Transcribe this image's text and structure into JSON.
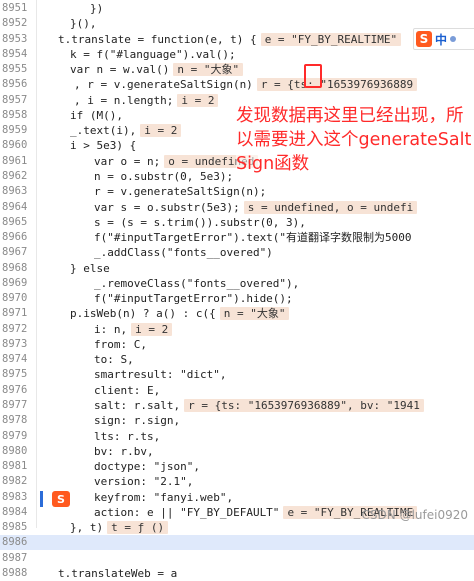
{
  "editor": {
    "lines": [
      {
        "n": "8951",
        "t": "})"
      },
      {
        "n": "8952",
        "t": "}(),"
      },
      {
        "n": "8953",
        "t": "t.translate = function(e, t) {",
        "h": "e = \"FY_BY_REALTIME\""
      },
      {
        "n": "8954",
        "t": "k = f(\"#language\").val();"
      },
      {
        "n": "8955",
        "t": "var n = w.val()",
        "h": "n = \"大象\""
      },
      {
        "n": "8956",
        "t": ", r = v.generateSaltSign(n)",
        "h": "r = {ts: \"1653976936889"
      },
      {
        "n": "8957",
        "t": ", i = n.length;",
        "h": "i = 2"
      },
      {
        "n": "8958",
        "t": "if (M(),"
      },
      {
        "n": "8959",
        "t": "_.text(i),",
        "h": "i = 2"
      },
      {
        "n": "8960",
        "t": "i > 5e3) {"
      },
      {
        "n": "8961",
        "t": "var o = n;",
        "h": "o = undefined"
      },
      {
        "n": "8962",
        "t": "n = o.substr(0, 5e3);"
      },
      {
        "n": "8963",
        "t": "r = v.generateSaltSign(n);"
      },
      {
        "n": "8964",
        "t": "var s = o.substr(5e3);",
        "h": "s = undefined, o = undefi"
      },
      {
        "n": "8965",
        "t": "s = (s = s.trim()).substr(0, 3),"
      },
      {
        "n": "8966",
        "t": "f(\"#inputTargetError\").text(\"有道翻译字数限制为5000"
      },
      {
        "n": "8967",
        "t": "_.addClass(\"fonts__overed\")"
      },
      {
        "n": "8968",
        "t": "} else"
      },
      {
        "n": "8969",
        "t": "_.removeClass(\"fonts__overed\"),"
      },
      {
        "n": "8970",
        "t": "f(\"#inputTargetError\").hide();"
      },
      {
        "n": "8971",
        "t": "p.isWeb(n) ? a() : c({",
        "h": "n = \"大象\""
      },
      {
        "n": "8972",
        "t": "i: n,",
        "h": "i = 2"
      },
      {
        "n": "8973",
        "t": "from: C,"
      },
      {
        "n": "8974",
        "t": "to: S,"
      },
      {
        "n": "8975",
        "t": "smartresult: \"dict\","
      },
      {
        "n": "8976",
        "t": "client: E,"
      },
      {
        "n": "8977",
        "t": "salt: r.salt,",
        "h": "r = {ts: \"1653976936889\", bv: \"1941"
      },
      {
        "n": "8978",
        "t": "sign: r.sign,"
      },
      {
        "n": "8979",
        "t": "lts: r.ts,"
      },
      {
        "n": "8980",
        "t": "bv: r.bv,"
      },
      {
        "n": "8981",
        "t": "doctype: \"json\","
      },
      {
        "n": "8982",
        "t": "version: \"2.1\","
      },
      {
        "n": "8983",
        "t": "keyfrom: \"fanyi.web\","
      },
      {
        "n": "8984",
        "t": "action: e || \"FY_BY_DEFAULT\"",
        "h": "e = \"FY_BY_REALTIME"
      },
      {
        "n": "8985",
        "t": "}, t)",
        "h": "t = ƒ ()"
      },
      {
        "n": "8986",
        "t": ""
      },
      {
        "n": "8987",
        "t": ""
      },
      {
        "n": "8988",
        "t": "t.translateWeb = a"
      }
    ]
  },
  "annotation": {
    "text": "发现数据再这里已经出现，所以需要进入这个generateSaltSign函数"
  },
  "ime": {
    "logo": "S",
    "mode": "中",
    "small_logo": "S"
  },
  "watermark": "CSDN @lufei0920"
}
